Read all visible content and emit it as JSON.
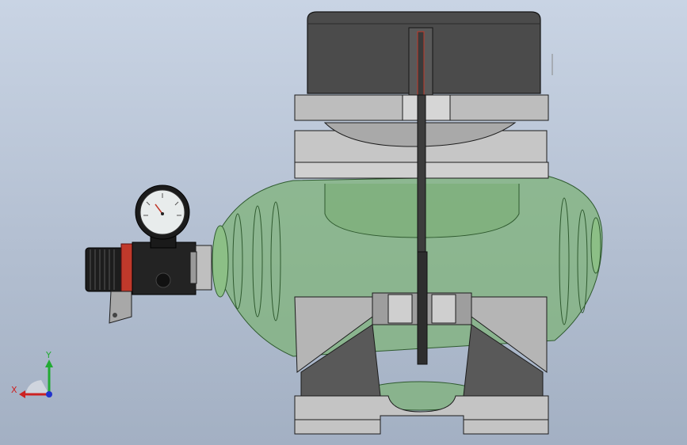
{
  "viewport": {
    "background_top": "#c9d4e4",
    "background_bottom": "#a3b0c3",
    "model_colors": {
      "tank_green": "#7fb37a",
      "metal_light": "#c9c9c9",
      "metal_dark": "#4a4a4a",
      "outline": "#1c1c1c",
      "accent_red": "#c0392b"
    }
  },
  "triad": {
    "x_label": "X",
    "y_label": "Y",
    "x_color": "#cc2222",
    "y_color": "#22aa33",
    "z_color": "#2233cc"
  },
  "model": {
    "parts": [
      "handle-housing",
      "frame",
      "air-tank",
      "regulator",
      "pressure-gauge",
      "mounting-bracket",
      "motor-shaft"
    ]
  }
}
